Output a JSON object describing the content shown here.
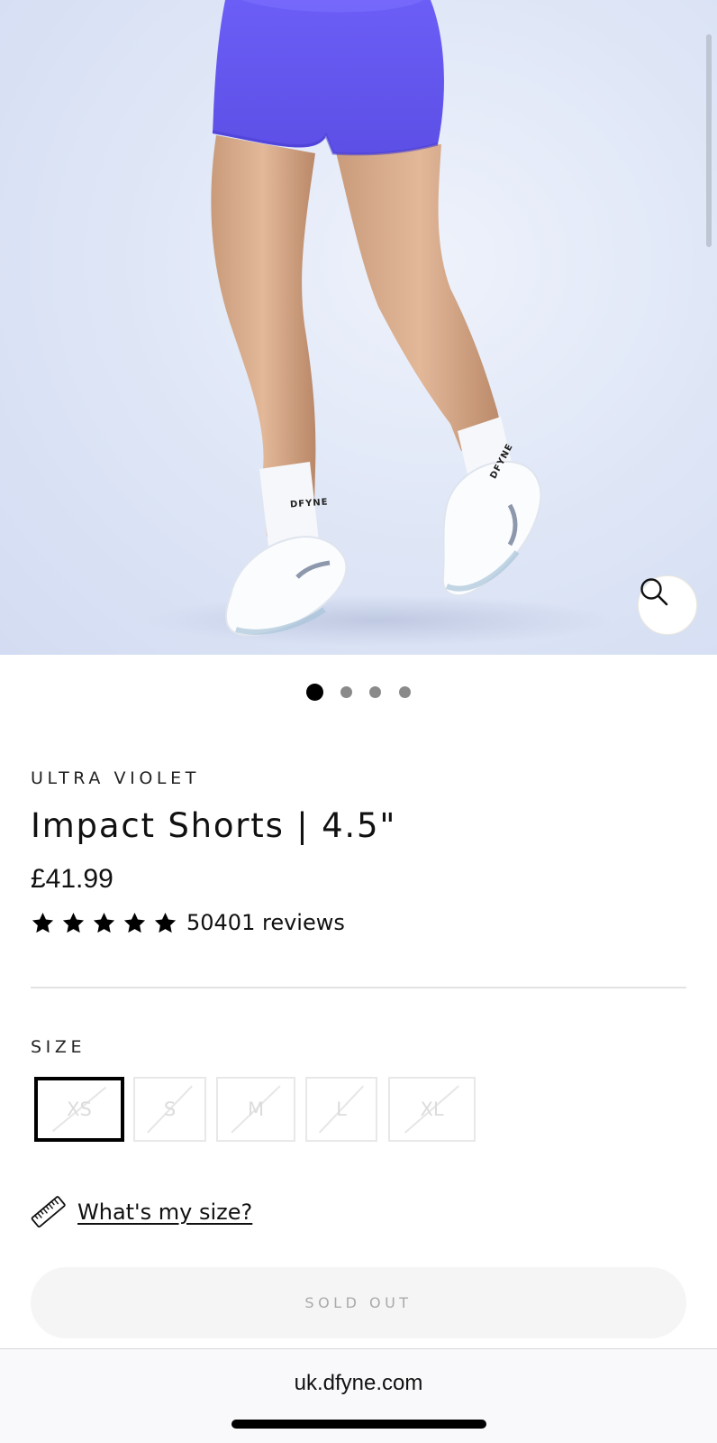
{
  "product": {
    "color_name": "ULTRA VIOLET",
    "title": "Impact Shorts | 4.5\"",
    "price": "£41.99",
    "rating_stars": 5,
    "review_count_text": "50401 reviews"
  },
  "gallery": {
    "image_alt": "Model wearing violet shorts with white socks and sneakers",
    "sock_logo_text": "DFYNE",
    "total_images": 4,
    "current_index": 1,
    "zoom_icon": "search-icon"
  },
  "size": {
    "label": "SIZE",
    "options": [
      {
        "label": "XS",
        "available": false,
        "selected": true
      },
      {
        "label": "S",
        "available": false,
        "selected": false
      },
      {
        "label": "M",
        "available": false,
        "selected": false
      },
      {
        "label": "L",
        "available": false,
        "selected": false
      },
      {
        "label": "XL",
        "available": false,
        "selected": false
      }
    ],
    "guide_icon": "ruler-icon",
    "guide_label": "What's my size?"
  },
  "cart": {
    "button_label": "SOLD OUT"
  },
  "browser": {
    "url": "uk.dfyne.com"
  },
  "colors": {
    "accent_violet": "#6a5cf0",
    "selected_border": "#000000",
    "disabled_text": "#dcdcdc",
    "sold_out_bg": "#f5f5f5"
  }
}
